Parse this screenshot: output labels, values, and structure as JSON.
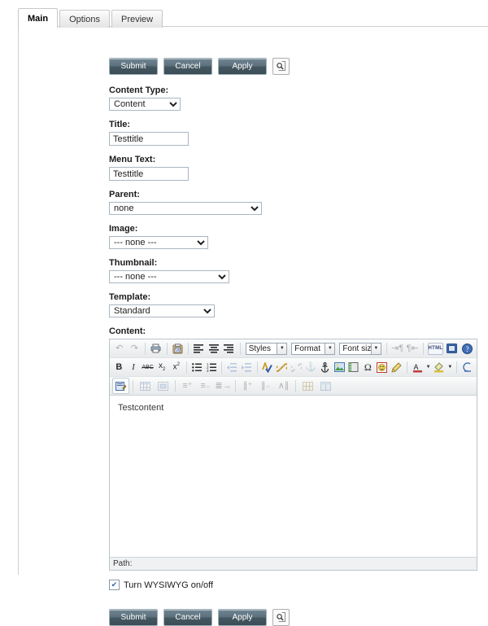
{
  "tabs": [
    {
      "label": "Main",
      "active": true
    },
    {
      "label": "Options",
      "active": false
    },
    {
      "label": "Preview",
      "active": false
    }
  ],
  "actions": {
    "submit_label": "Submit",
    "cancel_label": "Cancel",
    "apply_label": "Apply",
    "preview_icon": "magnifier-page-icon"
  },
  "fields": {
    "content_type": {
      "label": "Content Type:",
      "value": "Content"
    },
    "title": {
      "label": "Title:",
      "value": "Testtitle"
    },
    "menu_text": {
      "label": "Menu Text:",
      "value": "Testtitle"
    },
    "parent": {
      "label": "Parent:",
      "value": "none"
    },
    "image": {
      "label": "Image:",
      "value": "--- none ---"
    },
    "thumbnail": {
      "label": "Thumbnail:",
      "value": "--- none ---"
    },
    "template": {
      "label": "Template:",
      "value": "Standard"
    },
    "content": {
      "label": "Content:",
      "value": "Testcontent"
    }
  },
  "editor": {
    "selects": {
      "styles": "Styles",
      "format": "Format",
      "font_size": "Font size"
    },
    "html_label": "HTML",
    "row1_icons": [
      "undo-icon",
      "redo-icon",
      "print-icon",
      "paste-from-word-icon",
      "align-left-icon",
      "align-center-icon",
      "align-right-icon"
    ],
    "row1_right_icons": [
      "direction-ltr-icon",
      "direction-rtl-icon",
      "html-source-icon",
      "fullscreen-icon",
      "help-icon"
    ],
    "row2_icons": [
      "bold-icon",
      "italic-icon",
      "strikethrough-icon",
      "subscript-icon",
      "superscript-icon",
      "bullet-list-icon",
      "numbered-list-icon",
      "outdent-icon",
      "indent-icon",
      "spellcheck-icon",
      "insert-link-icon",
      "unlink-icon",
      "anchor-icon",
      "insert-image-icon",
      "insert-media-icon",
      "special-character-icon",
      "emoticon-icon",
      "cleanup-icon",
      "text-color-icon",
      "background-color-icon",
      "remove-format-icon"
    ],
    "row3_icons": [
      "edit-css-icon",
      "insert-table-icon",
      "table-properties-icon",
      "row-properties-icon",
      "insert-row-before-icon",
      "insert-row-after-icon",
      "delete-row-icon",
      "insert-column-before-icon",
      "insert-column-after-icon",
      "delete-column-icon",
      "split-cell-icon",
      "merge-cell-icon"
    ],
    "path_label": "Path:"
  },
  "wysiwyg_toggle": {
    "label": "Turn WYSIWYG on/off",
    "checked": true,
    "check_glyph": "✔"
  },
  "colors": {
    "button_dark": "#44565f",
    "tab_border": "#c8c8c8",
    "field_border": "#a9b6c2"
  }
}
